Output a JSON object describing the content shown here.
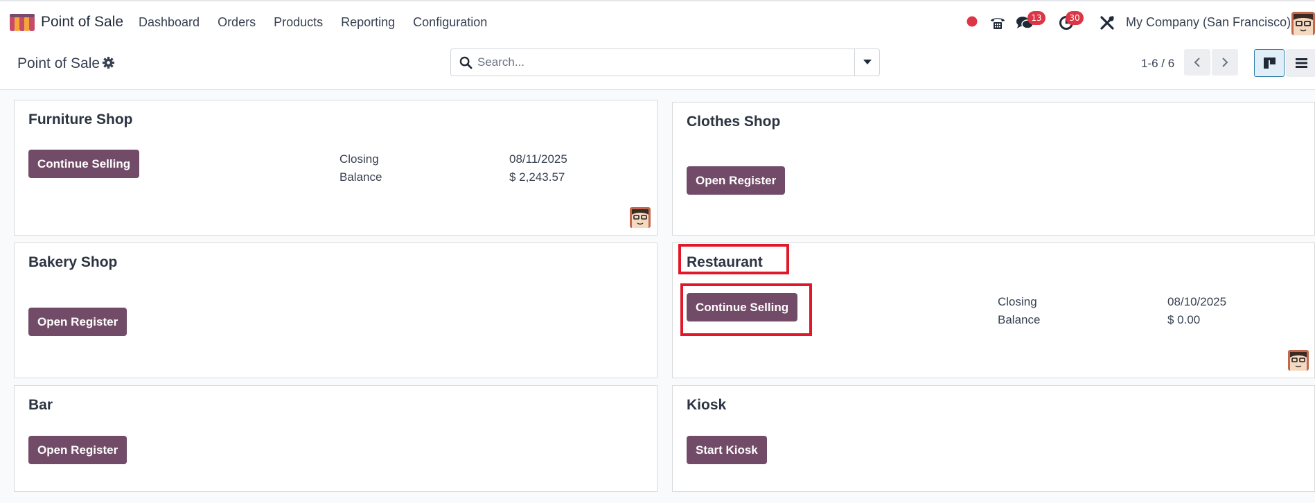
{
  "navbar": {
    "app_name": "Point of Sale",
    "menu": [
      "Dashboard",
      "Orders",
      "Products",
      "Reporting",
      "Configuration"
    ],
    "messages_count": "13",
    "activities_count": "30",
    "company": "My Company (San Francisco)"
  },
  "control_panel": {
    "title": "Point of Sale",
    "search_placeholder": "Search...",
    "pager": "1-6 / 6"
  },
  "cards": [
    {
      "title": "Furniture Shop",
      "button": "Continue Selling",
      "closing_label": "Closing",
      "closing_value": "08/11/2025",
      "balance_label": "Balance",
      "balance_value": "$ 2,243.57"
    },
    {
      "title": "Clothes Shop",
      "button": "Open Register"
    },
    {
      "title": "Bakery Shop",
      "button": "Open Register"
    },
    {
      "title": "Restaurant",
      "button": "Continue Selling",
      "closing_label": "Closing",
      "closing_value": "08/10/2025",
      "balance_label": "Balance",
      "balance_value": "$ 0.00"
    },
    {
      "title": "Bar",
      "button": "Open Register"
    },
    {
      "title": "Kiosk",
      "button": "Start Kiosk"
    }
  ],
  "colors": {
    "primary_button": "#714b67",
    "badge": "#dc3545",
    "highlight": "#e0182a",
    "status_dot": "#dc3545"
  },
  "icons": [
    "pos-logo-icon",
    "record-dot-icon",
    "phone-icon",
    "chat-icon",
    "clock-icon",
    "tools-icon",
    "gear-icon",
    "search-icon",
    "caret-down-icon",
    "chevron-left-icon",
    "chevron-right-icon",
    "kanban-view-icon",
    "list-view-icon"
  ]
}
